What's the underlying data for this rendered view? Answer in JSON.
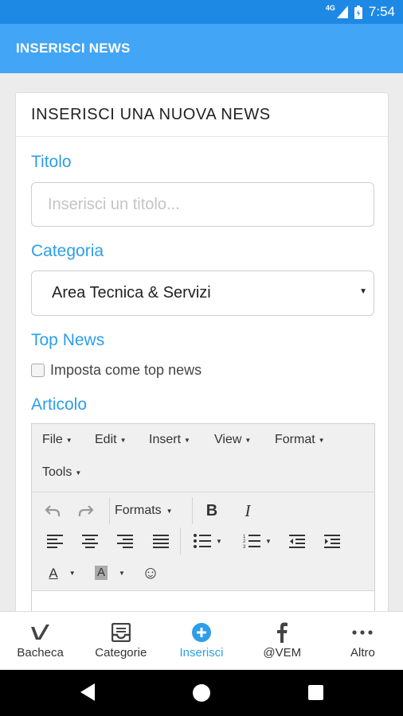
{
  "status_bar": {
    "network": "4G",
    "time": "7:54"
  },
  "app_bar": {
    "title": "INSERISCI NEWS"
  },
  "form": {
    "header": "INSERISCI UNA NUOVA NEWS",
    "title_label": "Titolo",
    "title_placeholder": "Inserisci un titolo...",
    "title_value": "",
    "category_label": "Categoria",
    "category_value": "Area Tecnica & Servizi",
    "top_news_label": "Top News",
    "top_news_checkbox_label": "Imposta come top news",
    "top_news_checked": false,
    "article_label": "Articolo"
  },
  "editor": {
    "menu": [
      "File",
      "Edit",
      "Insert",
      "View",
      "Format",
      "Tools"
    ],
    "formats_label": "Formats",
    "bold_glyph": "B",
    "italic_glyph": "I",
    "text_color_glyph": "A",
    "bg_color_glyph": "A",
    "emoticon_glyph": "☺"
  },
  "bottom_nav": [
    {
      "label": "Bacheca",
      "icon": "check-icon",
      "active": false
    },
    {
      "label": "Categorie",
      "icon": "inbox-icon",
      "active": false
    },
    {
      "label": "Inserisci",
      "icon": "add-circle-icon",
      "active": true
    },
    {
      "label": "@VEM",
      "icon": "facebook-icon",
      "active": false
    },
    {
      "label": "Altro",
      "icon": "more-icon",
      "active": false
    }
  ],
  "colors": {
    "primary": "#42a5f5",
    "status_bar": "#1e88e5",
    "accent": "#2e9ee8"
  }
}
